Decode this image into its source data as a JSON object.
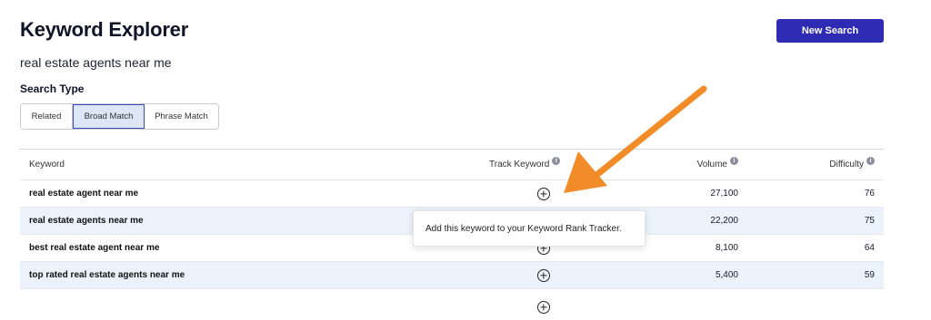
{
  "header": {
    "title": "Keyword Explorer",
    "new_search_label": "New Search",
    "query": "real estate agents near me"
  },
  "search_type": {
    "label": "Search Type",
    "options": [
      "Related",
      "Broad Match",
      "Phrase Match"
    ],
    "selected": "Broad Match"
  },
  "table": {
    "columns": {
      "keyword": "Keyword",
      "track": "Track Keyword",
      "volume": "Volume",
      "difficulty": "Difficulty"
    },
    "info_icon_glyph": "i",
    "rows": [
      {
        "keyword": "real estate agent near me",
        "volume": "27,100",
        "difficulty": "76"
      },
      {
        "keyword": "real estate agents near me",
        "volume": "22,200",
        "difficulty": "75"
      },
      {
        "keyword": "best real estate agent near me",
        "volume": "8,100",
        "difficulty": "64"
      },
      {
        "keyword": "top rated real estate agents near me",
        "volume": "5,400",
        "difficulty": "59"
      }
    ]
  },
  "tooltip": {
    "text": "Add this keyword to your Keyword Rank Tracker."
  },
  "colors": {
    "primary_button": "#2f2bb5",
    "selected_segment": "#dde6f7",
    "alt_row": "#ebf2fb",
    "annotation_arrow": "#f28c28"
  },
  "icons": {
    "track": "plus-circle-icon",
    "info": "info-icon",
    "annotation": "arrow-icon"
  }
}
